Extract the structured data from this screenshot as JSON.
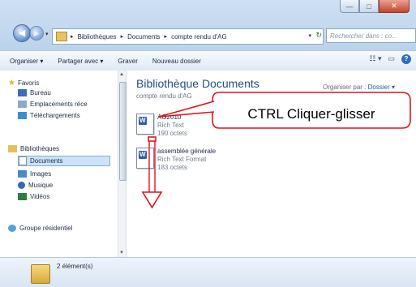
{
  "window": {
    "controls": {
      "minimize_icon": "—",
      "maximize_icon": "□",
      "close_icon": "✕"
    }
  },
  "address_bar": {
    "breadcrumbs": [
      "Bibliothèques",
      "Documents",
      "compte rendu d'AG"
    ],
    "search_placeholder": "Rechercher dans : co..."
  },
  "toolbar": {
    "organize": "Organiser ▾",
    "share": "Partager avec ▾",
    "burn": "Graver",
    "new_folder": "Nouveau dossier"
  },
  "sidebar": {
    "favorites": "Favoris",
    "items": [
      "Bureau",
      "Emplacements réce",
      "Téléchargements"
    ],
    "libraries": "Bibliothèques",
    "library_items": [
      "Documents",
      "Images",
      "Musique",
      "Vidéos"
    ],
    "homegroup": "Groupe résidentiel"
  },
  "content": {
    "title": "Bibliothèque Documents",
    "subtitle": "compte rendu d'AG",
    "arrange_label": "Organiser par :",
    "arrange_value": "Dossier ▾",
    "files": [
      {
        "name": "AG2010",
        "type": "Rich Text",
        "size": "190 octets"
      },
      {
        "name": "assemblée générale",
        "type": "Rich Text Format",
        "size": "183 octets"
      }
    ]
  },
  "status_bar": {
    "count": "2 élément(s)"
  },
  "annotation": {
    "text": "CTRL Cliquer-glisser",
    "color": "#e0141e"
  },
  "colors": {
    "accent": "#1d4f86",
    "toolbar_bg": "#dfe9f6",
    "annotation": "#e0141e"
  }
}
